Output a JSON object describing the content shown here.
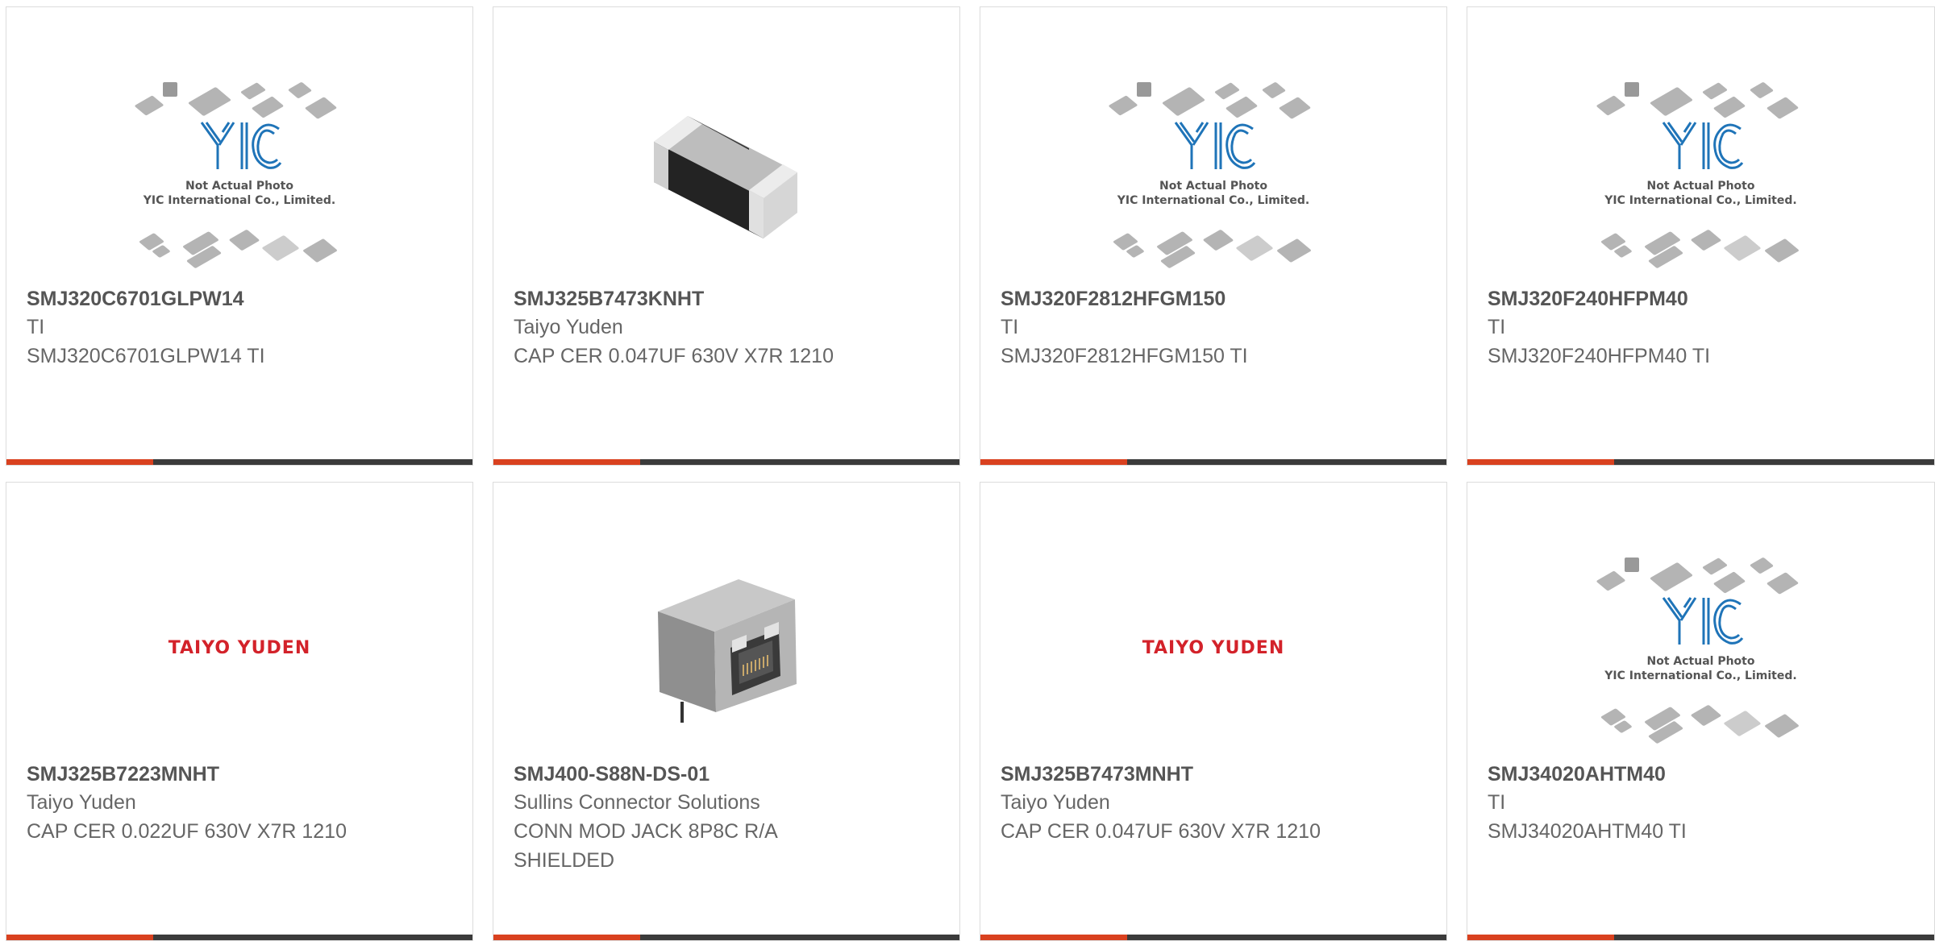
{
  "products": [
    {
      "part": "SMJ320C6701GLPW14",
      "brand": "TI",
      "desc": "SMJ320C6701GLPW14 TI",
      "image": "yic-placeholder",
      "image_text": [
        "Not Actual Photo",
        "YIC International Co., Limited."
      ]
    },
    {
      "part": "SMJ325B7473KNHT",
      "brand": "Taiyo Yuden",
      "desc": "CAP CER 0.047UF 630V X7R 1210",
      "image": "smd-capacitor"
    },
    {
      "part": "SMJ320F2812HFGM150",
      "brand": "TI",
      "desc": "SMJ320F2812HFGM150 TI",
      "image": "yic-placeholder",
      "image_text": [
        "Not Actual Photo",
        "YIC International Co., Limited."
      ]
    },
    {
      "part": "SMJ320F240HFPM40",
      "brand": "TI",
      "desc": "SMJ320F240HFPM40 TI",
      "image": "yic-placeholder",
      "image_text": [
        "Not Actual Photo",
        "YIC International Co., Limited."
      ]
    },
    {
      "part": "SMJ325B7223MNHT",
      "brand": "Taiyo Yuden",
      "desc": "CAP CER 0.022UF 630V X7R 1210",
      "image": "taiyo-yuden-logo",
      "logo_text": "TAIYO YUDEN"
    },
    {
      "part": "SMJ400-S88N-DS-01",
      "brand": "Sullins Connector Solutions",
      "desc": "CONN MOD JACK 8P8C R/A SHIELDED",
      "image": "rj45-jack"
    },
    {
      "part": "SMJ325B7473MNHT",
      "brand": "Taiyo Yuden",
      "desc": "CAP CER 0.047UF 630V X7R 1210",
      "image": "taiyo-yuden-logo",
      "logo_text": "TAIYO YUDEN"
    },
    {
      "part": "SMJ34020AHTM40",
      "brand": "TI",
      "desc": "SMJ34020AHTM40 TI",
      "image": "yic-placeholder",
      "image_text": [
        "Not Actual Photo",
        "YIC International Co., Limited."
      ]
    }
  ],
  "colors": {
    "accent": "#d9411f",
    "bar": "#3b3b3b",
    "logo_blue": "#1f74b8",
    "taiyo_red": "#d3222a"
  }
}
